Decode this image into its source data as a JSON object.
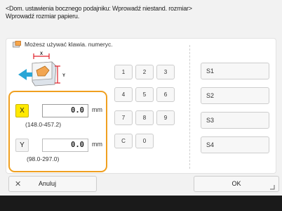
{
  "header": {
    "line1": "<Dom. ustawienia bocznego podajniku: Wprowadź niestand. rozmiar>",
    "line2": "Wprowadź rozmiar papieru."
  },
  "hint": {
    "text": "Możesz używać klawia. numeryc.",
    "icon": "keyboard-icon"
  },
  "diagram": {
    "x_label": "X",
    "y_label": "Y",
    "icon": "paper-size-diagram-icon"
  },
  "fields": {
    "x": {
      "label": "X",
      "value": "0.0",
      "unit": "mm",
      "range": "(148.0-457.2)",
      "selected": true
    },
    "y": {
      "label": "Y",
      "value": "0.0",
      "unit": "mm",
      "range": "(98.0-297.0)",
      "selected": false
    }
  },
  "keypad": {
    "row1": [
      "1",
      "2",
      "3"
    ],
    "row2": [
      "4",
      "5",
      "6"
    ],
    "row3": [
      "7",
      "8",
      "9"
    ],
    "row4": [
      "C",
      "0"
    ]
  },
  "memory": [
    "S1",
    "S2",
    "S3",
    "S4"
  ],
  "buttons": {
    "cancel": "Anuluj",
    "ok": "OK"
  },
  "colors": {
    "accent_orange": "#f0a020",
    "selected_yellow": "#ffe900"
  }
}
